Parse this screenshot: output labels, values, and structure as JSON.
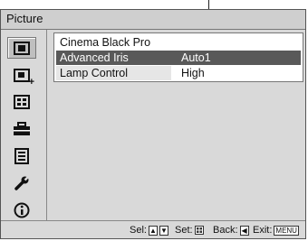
{
  "title": "Picture",
  "sidebar": {
    "icons": [
      {
        "name": "picture-icon",
        "selected": true
      },
      {
        "name": "advanced-picture-icon",
        "selected": false
      },
      {
        "name": "screen-icon",
        "selected": false
      },
      {
        "name": "setup-icon",
        "selected": false
      },
      {
        "name": "menu-setting-icon",
        "selected": false
      },
      {
        "name": "installation-icon",
        "selected": false
      },
      {
        "name": "information-icon",
        "selected": false
      }
    ]
  },
  "menu": {
    "items": [
      {
        "label": "Cinema Black Pro",
        "value": ""
      },
      {
        "label": "Advanced Iris",
        "value": "Auto1"
      },
      {
        "label": "Lamp Control",
        "value": "High"
      }
    ]
  },
  "footer": {
    "sel_label": "Sel:",
    "sel_keys": [
      "▲",
      "▼"
    ],
    "set_label": "Set:",
    "back_label": "Back:",
    "back_key": "◀",
    "exit_label": "Exit:",
    "exit_key": "MENU"
  },
  "colors": {
    "highlight": "#595959",
    "panel": "#d9d9d9"
  }
}
